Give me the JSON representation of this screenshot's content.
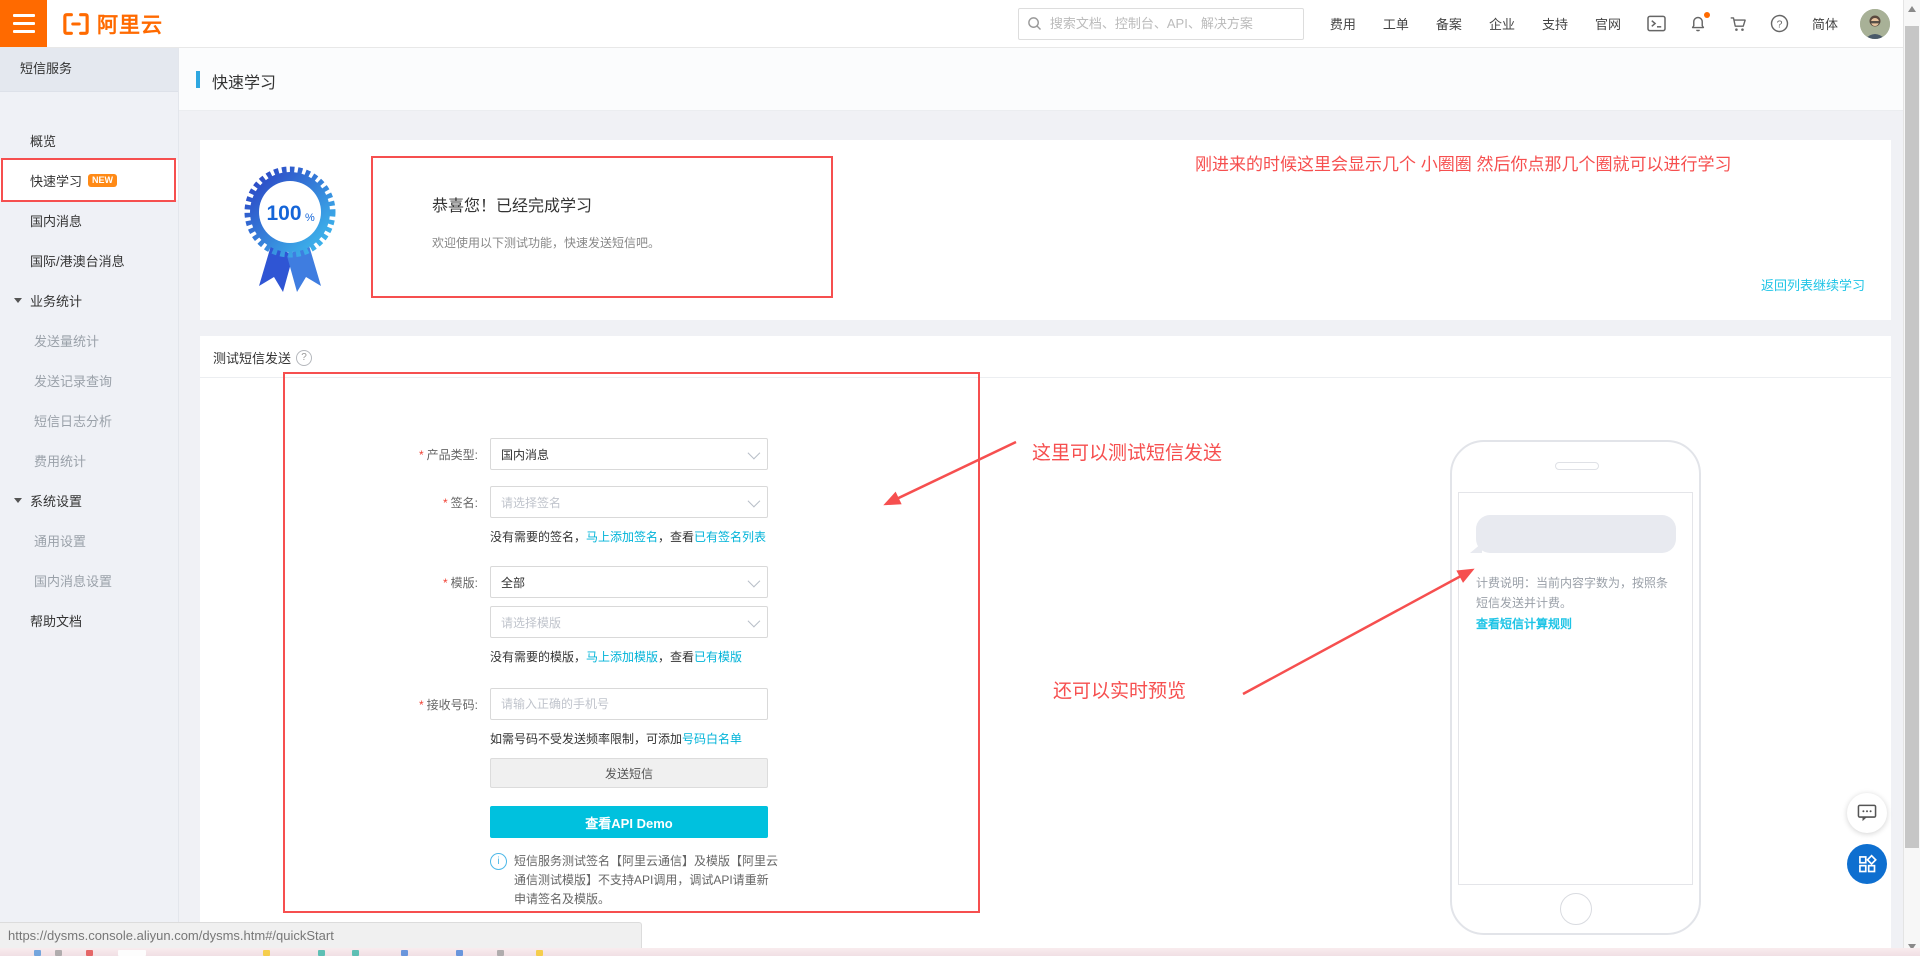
{
  "topnav": {
    "logo": "阿里云",
    "search_placeholder": "搜索文档、控制台、API、解决方案",
    "menu": [
      {
        "id": "fee",
        "label": "费用"
      },
      {
        "id": "ticket",
        "label": "工单"
      },
      {
        "id": "icp",
        "label": "备案"
      },
      {
        "id": "enterprise",
        "label": "企业"
      },
      {
        "id": "support",
        "label": "支持"
      },
      {
        "id": "website",
        "label": "官网"
      }
    ],
    "language": "简体"
  },
  "sidebar": {
    "title": "短信服务",
    "items": [
      {
        "id": "overview",
        "label": "概览",
        "level": 1
      },
      {
        "id": "quick-start",
        "label": "快速学习",
        "level": 1,
        "badge": "NEW",
        "active": true
      },
      {
        "id": "domestic-message",
        "label": "国内消息",
        "level": 1
      },
      {
        "id": "intl-message",
        "label": "国际/港澳台消息",
        "level": 1
      },
      {
        "id": "biz-stats",
        "label": "业务统计",
        "level": 0,
        "expandable": true
      },
      {
        "id": "send-volume-stats",
        "label": "发送量统计",
        "level": 2,
        "muted": true
      },
      {
        "id": "send-record-query",
        "label": "发送记录查询",
        "level": 2,
        "muted": true
      },
      {
        "id": "sms-log-analysis",
        "label": "短信日志分析",
        "level": 2,
        "muted": true
      },
      {
        "id": "fee-stats",
        "label": "费用统计",
        "level": 2,
        "muted": true
      },
      {
        "id": "system-settings",
        "label": "系统设置",
        "level": 0,
        "expandable": true
      },
      {
        "id": "general-settings",
        "label": "通用设置",
        "level": 2,
        "muted": true
      },
      {
        "id": "domestic-message-settings",
        "label": "国内消息设置",
        "level": 2,
        "muted": true
      },
      {
        "id": "help-docs",
        "label": "帮助文档",
        "level": 1
      }
    ]
  },
  "page": {
    "title": "快速学习"
  },
  "congrats": {
    "percent": "100",
    "percent_sign": "%",
    "title": "恭喜您！已经完成学习",
    "subtitle": "欢迎使用以下测试功能，快速发送短信吧。",
    "back_link": "返回列表继续学习"
  },
  "test": {
    "section_title": "测试短信发送",
    "required_mark": "*",
    "product_label": "产品类型:",
    "product_value": "国内消息",
    "signature_label": "签名:",
    "signature_placeholder": "请选择签名",
    "signature_help": {
      "p1": "没有需要的签名，",
      "link1": "马上添加签名",
      "p2": "，查看",
      "link2": "已有签名列表"
    },
    "template_label": "模版:",
    "template_value": "全部",
    "template_placeholder": "请选择模版",
    "template_help": {
      "p1": "没有需要的模版，",
      "link1": "马上添加模版",
      "p2": "，查看",
      "link2": "已有模版"
    },
    "phone_label": "接收号码:",
    "phone_placeholder": "请输入正确的手机号",
    "phone_help": {
      "p1": "如需号码不受发送频率限制，可添加",
      "link1": "号码白名单"
    },
    "send_button": "发送短信",
    "api_demo_button": "查看API Demo",
    "notice": "短信服务测试签名【阿里云通信】及模版【阿里云通信测试模版】不支持API调用，调试API请重新申请签名及模版。"
  },
  "preview": {
    "fee_note": "计费说明：当前内容字数为，按照条短信发送并计费。",
    "rule_link": "查看短信计算规则"
  },
  "annotations": {
    "note_top": "刚进来的时候这里会显示几个 小圈圈 然后你点那几个圈就可以进行学习",
    "note_form": "这里可以测试短信发送",
    "note_preview": "还可以实时预览"
  },
  "statusbar": {
    "url": "https://dysms.console.aliyun.com/dysms.htm#/quickStart"
  },
  "colors": {
    "brand_orange": "#ff6a00",
    "accent_cyan": "#00c1de",
    "annotation_red": "#f64f4f",
    "float_blue": "#0e6fd0",
    "title_bar_blue": "#2ea7e0"
  }
}
